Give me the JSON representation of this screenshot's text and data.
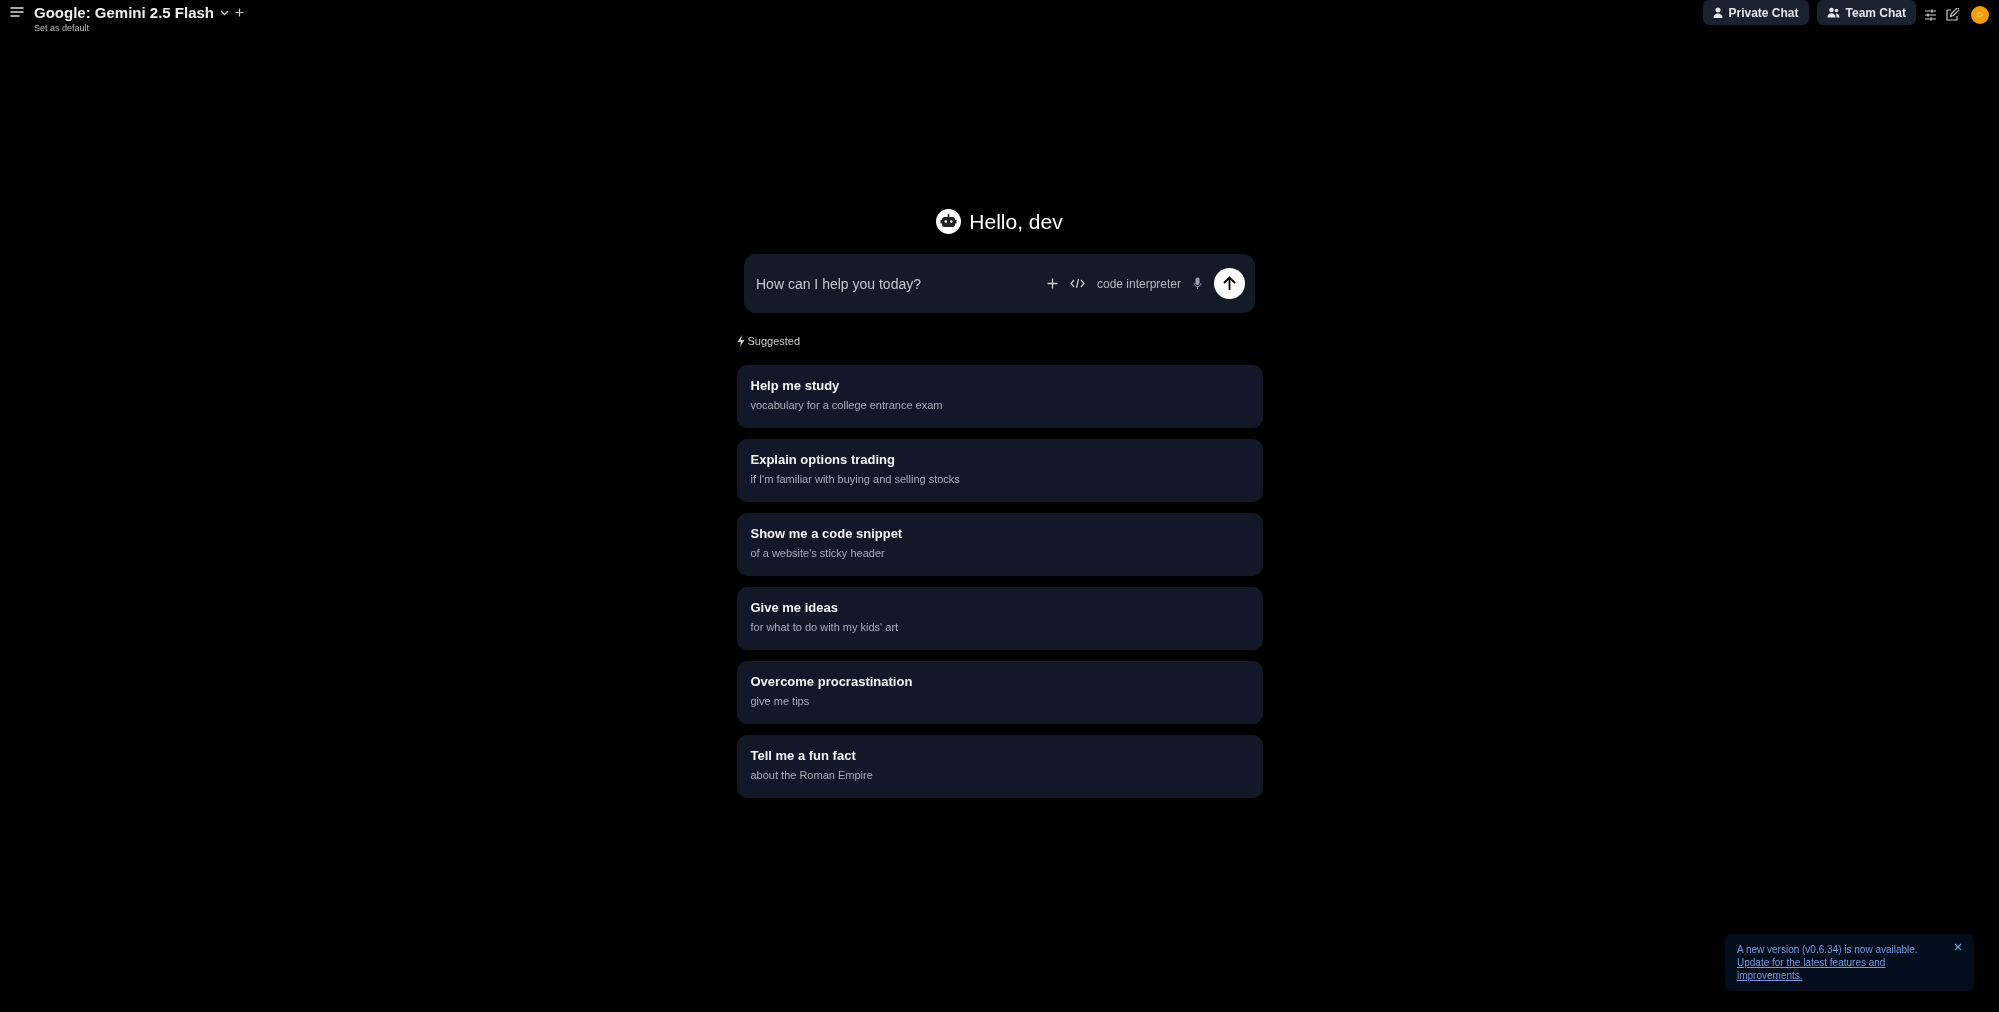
{
  "header": {
    "model_name": "Google: Gemini 2.5 Flash",
    "set_default": "Set as default",
    "buttons": [
      {
        "label": "Private Chat",
        "kind": "private"
      },
      {
        "label": "Team Chat",
        "kind": "team"
      }
    ],
    "avatar": "D"
  },
  "greeting": "Hello, dev",
  "composer": {
    "placeholder": "How can I help you today?",
    "tool": "code interpreter"
  },
  "suggested_label": "Suggested",
  "suggestions": [
    {
      "title": "Help me study",
      "subtitle": "vocabulary for a college entrance exam"
    },
    {
      "title": "Explain options trading",
      "subtitle": "if I'm familiar with buying and selling stocks"
    },
    {
      "title": "Show me a code snippet",
      "subtitle": "of a website's sticky header"
    },
    {
      "title": "Give me ideas",
      "subtitle": "for what to do with my kids' art"
    },
    {
      "title": "Overcome procrastination",
      "subtitle": "give me tips"
    },
    {
      "title": "Tell me a fun fact",
      "subtitle": "about the Roman Empire"
    }
  ],
  "toast": {
    "message": "A new version (v0.6.34) is now available.",
    "link": "Update for the latest features and improvements."
  }
}
